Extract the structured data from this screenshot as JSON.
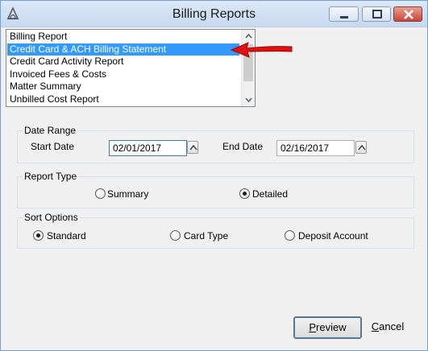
{
  "window": {
    "title": "Billing Reports",
    "accent": "#3399ff",
    "annotation_arrow_color": "#e01010"
  },
  "report_list": {
    "items": [
      {
        "label": "Billing Report"
      },
      {
        "label": "Credit Card & ACH Billing Statement"
      },
      {
        "label": "Credit Card Activity Report"
      },
      {
        "label": "Invoiced Fees & Costs"
      },
      {
        "label": "Matter Summary"
      },
      {
        "label": "Unbilled Cost Report"
      }
    ],
    "selected_index": 1
  },
  "date_range": {
    "legend": "Date Range",
    "start_label": "Start Date",
    "start_value": "02/01/2017",
    "end_label": "End Date",
    "end_value": "02/16/2017"
  },
  "report_type": {
    "legend": "Report Type",
    "options": [
      {
        "label": "Summary",
        "checked": false
      },
      {
        "label": "Detailed",
        "checked": true
      }
    ]
  },
  "sort_options": {
    "legend": "Sort Options",
    "options": [
      {
        "label": "Standard",
        "checked": true
      },
      {
        "label": "Card Type",
        "checked": false
      },
      {
        "label": "Deposit Account",
        "checked": false
      }
    ]
  },
  "buttons": {
    "preview": {
      "underlined": "P",
      "rest": "review"
    },
    "cancel": {
      "underlined": "C",
      "rest": "ancel"
    }
  }
}
